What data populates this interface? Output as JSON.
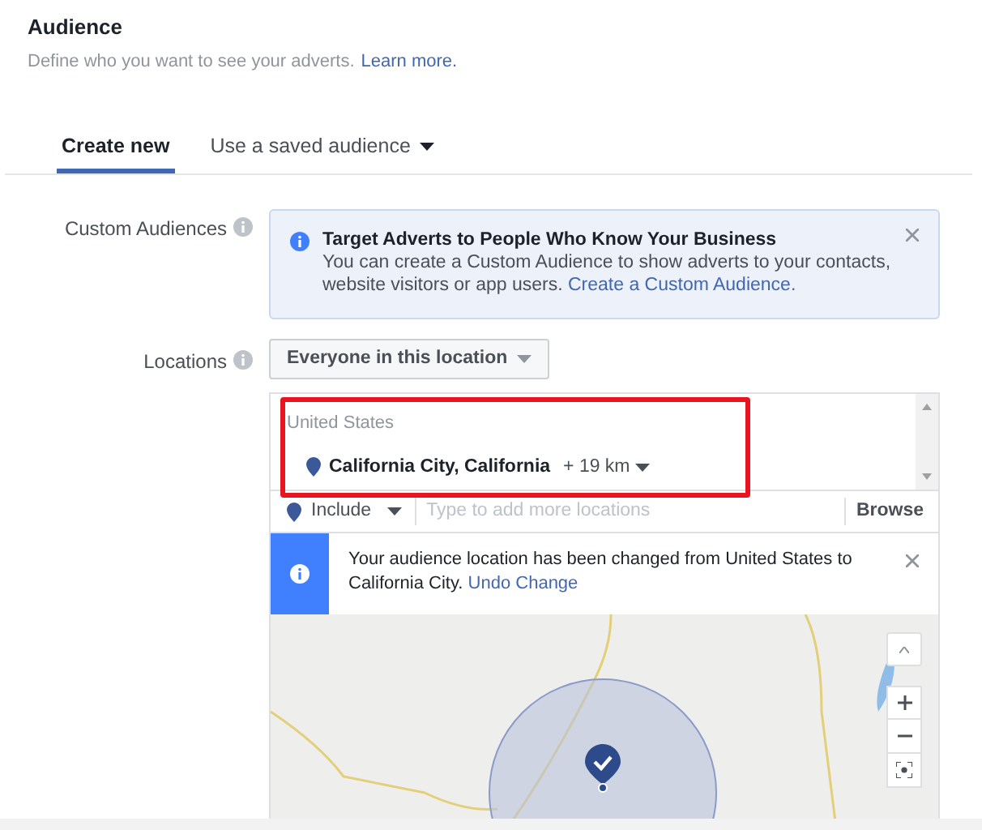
{
  "header": {
    "title": "Audience",
    "subtitle": "Define who you want to see your adverts.",
    "learn_more": "Learn more."
  },
  "tabs": [
    {
      "label": "Create new",
      "selected": true,
      "dropdown": false
    },
    {
      "label": "Use a saved audience",
      "selected": false,
      "dropdown": true
    }
  ],
  "custom_audiences": {
    "label": "Custom Audiences",
    "notice_title": "Target Adverts to People Who Know Your Business",
    "notice_text": "You can create a Custom Audience to show adverts to your contacts, website visitors or app users.",
    "notice_link": "Create a Custom Audience."
  },
  "locations": {
    "label": "Locations",
    "dropdown": "Everyone in this location",
    "country": "United States",
    "location": "California City, California",
    "radius": "+ 19 km",
    "highlighted": true,
    "include": "Include",
    "placeholder": "Type to add more locations",
    "browse": "Browse",
    "change_notice": "Your audience location has been changed from United States to California City.",
    "undo": "Undo Change"
  }
}
